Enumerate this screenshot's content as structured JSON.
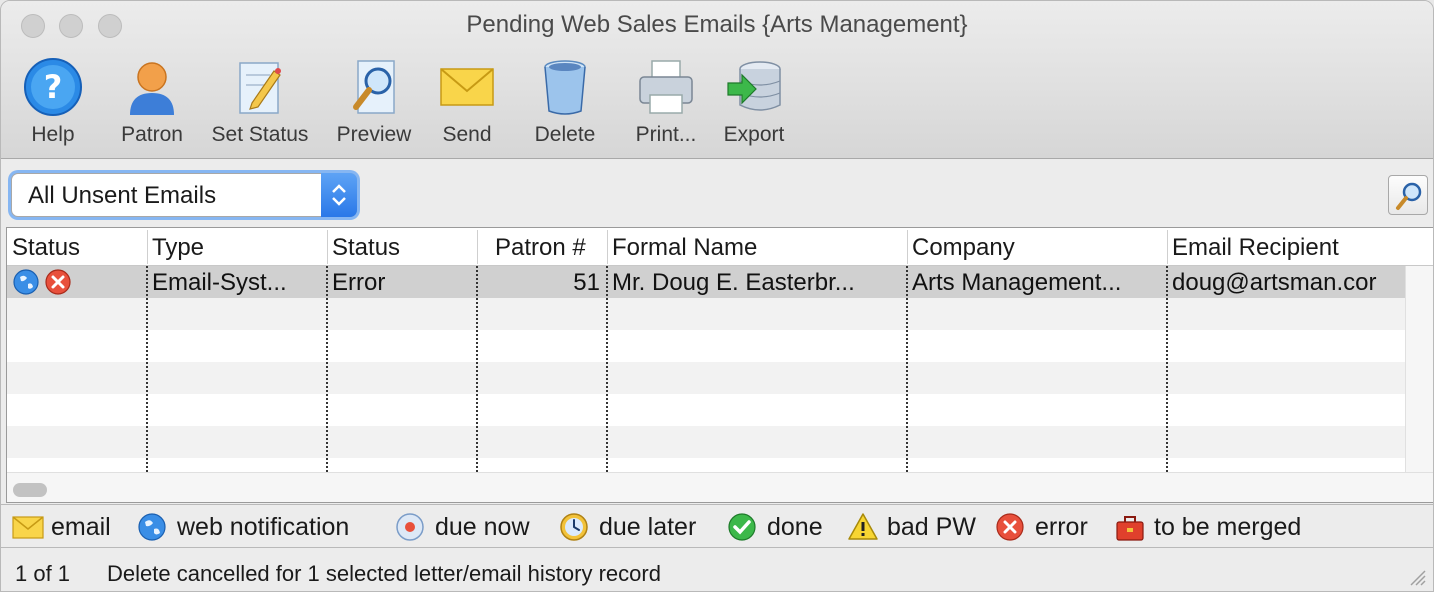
{
  "window": {
    "title": "Pending Web Sales Emails {Arts Management}"
  },
  "toolbar": {
    "items": [
      {
        "label": "Help",
        "icon": "help-icon"
      },
      {
        "label": "Patron",
        "icon": "patron-icon"
      },
      {
        "label": "Set Status",
        "icon": "set-status-icon"
      },
      {
        "label": "Preview",
        "icon": "preview-icon"
      },
      {
        "label": "Send",
        "icon": "send-envelope-icon"
      },
      {
        "label": "Delete",
        "icon": "trash-icon"
      },
      {
        "label": "Print...",
        "icon": "printer-icon"
      },
      {
        "label": "Export",
        "icon": "export-database-icon"
      }
    ]
  },
  "filter": {
    "selected": "All Unsent Emails"
  },
  "table": {
    "columns": [
      "Status",
      "Type",
      "Status",
      "Patron #",
      "Formal Name",
      "Company",
      "Email Recipient"
    ],
    "rows": [
      {
        "status_icons": [
          "web-notification-icon",
          "error-icon"
        ],
        "type": "Email-Syst...",
        "status": "Error",
        "patron_no": "51",
        "formal_name": "Mr. Doug E. Easterbr...",
        "company": "Arts Management...",
        "email_recipient": "doug@artsman.cor"
      }
    ]
  },
  "legend": {
    "items": [
      {
        "label": "email",
        "icon": "email-icon"
      },
      {
        "label": "web notification",
        "icon": "globe-icon"
      },
      {
        "label": "due now",
        "icon": "due-now-icon"
      },
      {
        "label": "due later",
        "icon": "clock-icon"
      },
      {
        "label": "done",
        "icon": "check-icon"
      },
      {
        "label": "bad PW",
        "icon": "warning-icon"
      },
      {
        "label": "error",
        "icon": "error-icon"
      },
      {
        "label": "to be merged",
        "icon": "toolbox-icon"
      }
    ]
  },
  "statusbar": {
    "count": "1 of 1",
    "message": "Delete cancelled for 1 selected letter/email history record"
  },
  "colors": {
    "accent": "#2a78e8",
    "focus_ring": "#86b6f2",
    "selected_row": "#d0d0d0"
  }
}
